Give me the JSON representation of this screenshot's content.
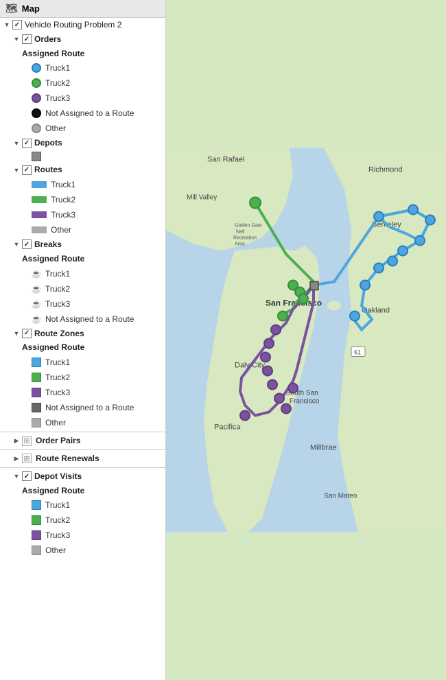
{
  "panel": {
    "header": "Map",
    "title": "Vehicle Routing Problem 2",
    "sections": {
      "orders": {
        "label": "Orders",
        "assigned_route_label": "Assigned Route",
        "items": [
          {
            "label": "Truck1",
            "color": "#4da6e0",
            "type": "circle"
          },
          {
            "label": "Truck2",
            "color": "#4caf50",
            "type": "circle"
          },
          {
            "label": "Truck3",
            "color": "#7b52a0",
            "type": "circle"
          },
          {
            "label": "Not Assigned to a Route",
            "color": "#111111",
            "type": "circle"
          },
          {
            "label": "Other",
            "color": "#aaaaaa",
            "type": "circle"
          }
        ]
      },
      "depots": {
        "label": "Depots",
        "symbol_color": "#888"
      },
      "routes": {
        "label": "Routes",
        "items": [
          {
            "label": "Truck1",
            "color": "#4da6e0",
            "type": "rect"
          },
          {
            "label": "Truck2",
            "color": "#4caf50",
            "type": "rect"
          },
          {
            "label": "Truck3",
            "color": "#7b52a0",
            "type": "rect"
          },
          {
            "label": "Other",
            "color": "#aaaaaa",
            "type": "rect"
          }
        ]
      },
      "breaks": {
        "label": "Breaks",
        "assigned_route_label": "Assigned Route",
        "items": [
          {
            "label": "Truck1",
            "color": "#4da6e0",
            "type": "cup"
          },
          {
            "label": "Truck2",
            "color": "#4caf50",
            "type": "cup"
          },
          {
            "label": "Truck3",
            "color": "#7b52a0",
            "type": "cup"
          },
          {
            "label": "Not Assigned to a Route",
            "color": "#333",
            "type": "cup"
          }
        ]
      },
      "route_zones": {
        "label": "Route Zones",
        "assigned_route_label": "Assigned Route",
        "items": [
          {
            "label": "Truck1",
            "color": "#4da6e0",
            "type": "square"
          },
          {
            "label": "Truck2",
            "color": "#4caf50",
            "type": "square"
          },
          {
            "label": "Truck3",
            "color": "#7b52a0",
            "type": "square"
          },
          {
            "label": "Not Assigned to a Route",
            "color": "#555555",
            "type": "square"
          },
          {
            "label": "Other",
            "color": "#aaaaaa",
            "type": "square"
          }
        ]
      },
      "order_pairs": {
        "label": "Order Pairs"
      },
      "route_renewals": {
        "label": "Route Renewals"
      },
      "depot_visits": {
        "label": "Depot Visits",
        "assigned_route_label": "Assigned Route",
        "items": [
          {
            "label": "Truck1",
            "color": "#4da6e0",
            "type": "square"
          },
          {
            "label": "Truck2",
            "color": "#4caf50",
            "type": "square"
          },
          {
            "label": "Truck3",
            "color": "#7b52a0",
            "type": "square"
          },
          {
            "label": "Other",
            "color": "#aaaaaa",
            "type": "square"
          }
        ]
      }
    }
  },
  "map": {
    "places": [
      "San Rafael",
      "Richmond",
      "Mill Valley",
      "Berkeley",
      "San Francisco",
      "Oakland",
      "Daly City",
      "South San Francisco",
      "Pacifica",
      "Millbrae",
      "San Mateo"
    ],
    "route_colors": {
      "truck1": "#4da6e0",
      "truck2": "#4caf50",
      "truck3": "#7b52a0"
    }
  }
}
